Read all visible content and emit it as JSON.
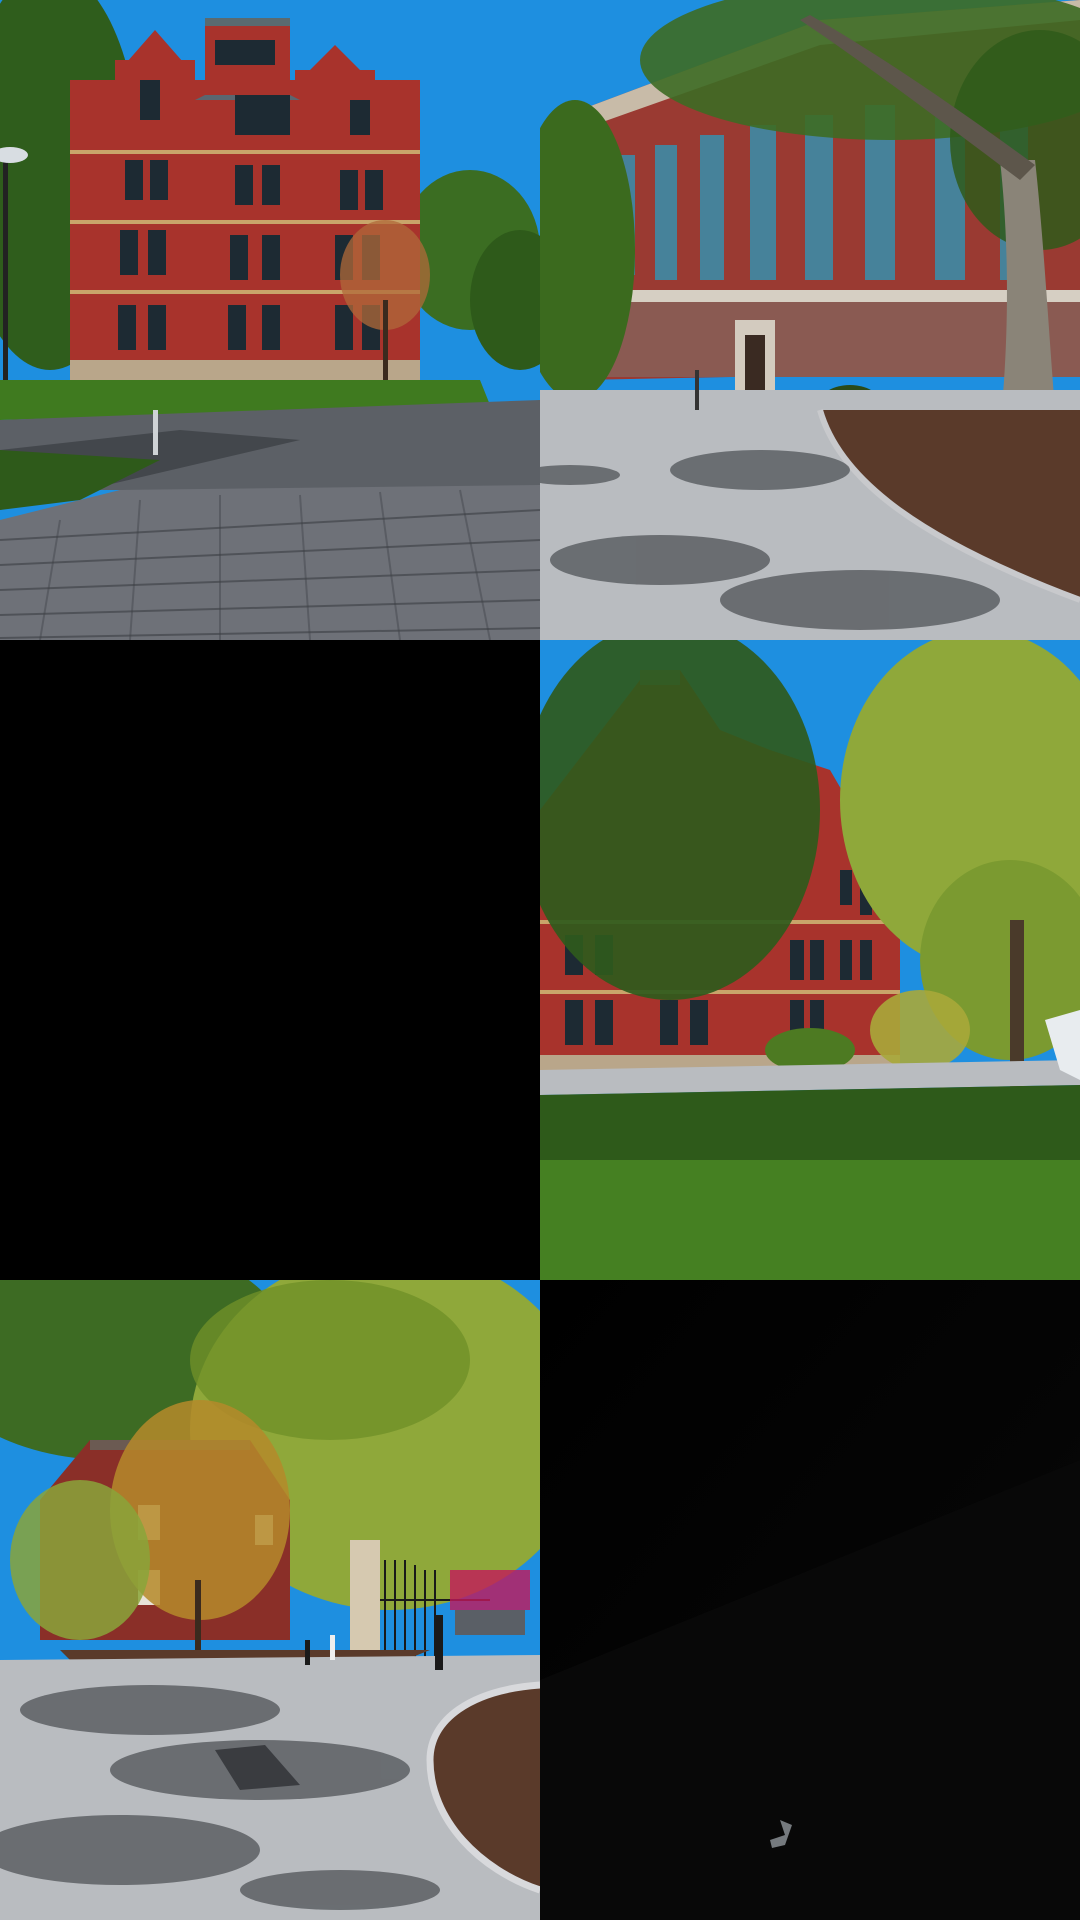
{
  "tiles": [
    {
      "name": "tile-victorian-brick-hall",
      "kind": "photo"
    },
    {
      "name": "tile-library-facade-tree",
      "kind": "photo"
    },
    {
      "name": "tile-black-blank",
      "kind": "blank"
    },
    {
      "name": "tile-brick-hall-trees-lawn",
      "kind": "photo"
    },
    {
      "name": "tile-gate-courtyard-trees",
      "kind": "photo"
    },
    {
      "name": "tile-dark-night-frame",
      "kind": "dark"
    }
  ],
  "colors": {
    "sky": "#1e8fe0",
    "brick": "#a8332c",
    "brick_dark": "#7e2420",
    "trim": "#c9a46a",
    "foliage": "#3c6a1e",
    "foliage_light": "#8fa83a",
    "grass": "#3f7a1f",
    "cobble": "#6e7178",
    "pavement": "#b9bcc0",
    "shadow": "#2a2d31"
  }
}
